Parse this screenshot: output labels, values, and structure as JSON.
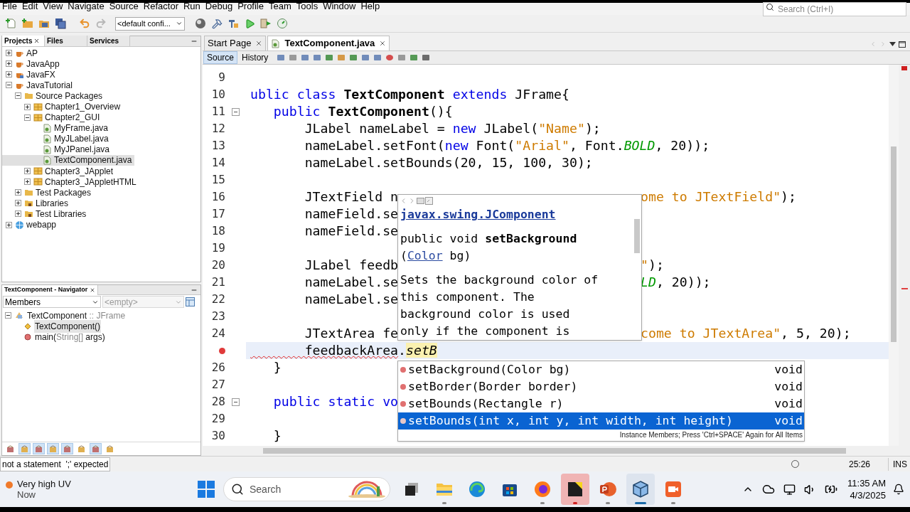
{
  "menu": [
    "File",
    "Edit",
    "View",
    "Navigate",
    "Source",
    "Refactor",
    "Run",
    "Debug",
    "Profile",
    "Team",
    "Tools",
    "Window",
    "Help"
  ],
  "search": {
    "placeholder": "Search (Ctrl+I)"
  },
  "toolbar": {
    "config": "<default confi..."
  },
  "projects_panel": {
    "tabs": [
      {
        "label": "Projects",
        "selected": true
      },
      {
        "label": "Files",
        "selected": false
      },
      {
        "label": "Services",
        "selected": false
      }
    ],
    "tree": [
      {
        "label": "AP",
        "kind": "project",
        "expanded": false,
        "selected": false
      },
      {
        "label": "JavaApp",
        "kind": "project",
        "expanded": false,
        "selected": false
      },
      {
        "label": "JavaFX",
        "kind": "fx-project",
        "expanded": false,
        "selected": false
      },
      {
        "label": "JavaTutorial",
        "kind": "project",
        "expanded": true,
        "selected": false,
        "children": [
          {
            "label": "Source Packages",
            "kind": "folder",
            "expanded": true,
            "selected": false,
            "children": [
              {
                "label": "Chapter1_Overview",
                "kind": "package",
                "expanded": false,
                "selected": false
              },
              {
                "label": "Chapter2_GUI",
                "kind": "package",
                "expanded": true,
                "selected": false,
                "children": [
                  {
                    "label": "MyFrame.java",
                    "kind": "java",
                    "selected": false
                  },
                  {
                    "label": "MyJLabel.java",
                    "kind": "java",
                    "selected": false
                  },
                  {
                    "label": "MyJPanel.java",
                    "kind": "java",
                    "selected": false
                  },
                  {
                    "label": "TextComponent.java",
                    "kind": "java",
                    "selected": true
                  }
                ]
              },
              {
                "label": "Chapter3_JApplet",
                "kind": "package",
                "expanded": false,
                "selected": false
              },
              {
                "label": "Chapter3_JAppletHTML",
                "kind": "package",
                "expanded": false,
                "selected": false
              }
            ]
          },
          {
            "label": "Test Packages",
            "kind": "folder",
            "expanded": false,
            "selected": false
          },
          {
            "label": "Libraries",
            "kind": "library",
            "expanded": false,
            "selected": false
          },
          {
            "label": "Test Libraries",
            "kind": "library",
            "expanded": false,
            "selected": false
          }
        ]
      },
      {
        "label": "webapp",
        "kind": "web",
        "expanded": false,
        "selected": false
      }
    ]
  },
  "navigator": {
    "title": "TextComponent - Navigator",
    "filter": "Members",
    "scope": "<empty>",
    "tree": [
      {
        "kind": "class",
        "expanded": true,
        "selected": false,
        "parts": [
          {
            "text": "TextComponent",
            "muted": false
          },
          {
            "text": " :: JFrame",
            "muted": true
          }
        ],
        "children": [
          {
            "kind": "constructor",
            "selected": true,
            "parts": [
              {
                "text": "TextComponent()",
                "muted": false
              }
            ]
          },
          {
            "kind": "method",
            "selected": false,
            "parts": [
              {
                "text": "main(",
                "muted": false
              },
              {
                "text": "String[]",
                "muted": true
              },
              {
                "text": " args)",
                "muted": false
              }
            ]
          }
        ]
      }
    ],
    "tools": [
      {
        "on": false
      },
      {
        "on": true
      },
      {
        "on": true
      },
      {
        "on": true
      },
      {
        "on": true
      },
      {
        "on": false
      },
      {
        "on": true
      },
      {
        "on": false
      }
    ]
  },
  "editor": {
    "tabs": [
      {
        "label": "Start Page",
        "selected": false
      },
      {
        "label": "TextComponent.java",
        "selected": true
      }
    ],
    "views": [
      {
        "label": "Source",
        "selected": true
      },
      {
        "label": "History",
        "selected": false
      }
    ],
    "lines": [
      {
        "number": "9",
        "error": false,
        "fold": false,
        "current": false
      },
      {
        "number": "10",
        "error": false,
        "fold": false,
        "current": false,
        "segments": [
          {
            "kind": "keyword",
            "text": "ublic"
          },
          {
            "kind": "keyword",
            "text": " class"
          },
          {
            "kind": "bold",
            "text": " TextComponent"
          },
          {
            "kind": "keyword",
            "text": " extends"
          },
          {
            "kind": "plain",
            "text": " JFrame{"
          }
        ]
      },
      {
        "number": "11",
        "error": false,
        "fold": true,
        "current": false,
        "segments": [
          {
            "kind": "keyword",
            "text": "   public"
          },
          {
            "kind": "bold",
            "text": " TextComponent"
          },
          {
            "kind": "plain",
            "text": "(){"
          }
        ]
      },
      {
        "number": "12",
        "error": false,
        "fold": false,
        "current": false,
        "segments": [
          {
            "kind": "plain",
            "text": "       JLabel nameLabel = "
          },
          {
            "kind": "keyword",
            "text": "new"
          },
          {
            "kind": "plain",
            "text": " JLabel("
          },
          {
            "kind": "string",
            "text": "\"Name\""
          },
          {
            "kind": "plain",
            "text": ");"
          }
        ]
      },
      {
        "number": "13",
        "error": false,
        "fold": false,
        "current": false,
        "segments": [
          {
            "kind": "plain",
            "text": "       nameLabel.setFont("
          },
          {
            "kind": "keyword",
            "text": "new"
          },
          {
            "kind": "plain",
            "text": " Font("
          },
          {
            "kind": "string",
            "text": "\"Arial\""
          },
          {
            "kind": "plain",
            "text": ", Font."
          },
          {
            "kind": "constant",
            "text": "BOLD"
          },
          {
            "kind": "plain",
            "text": ", 20));"
          }
        ]
      },
      {
        "number": "14",
        "error": false,
        "fold": false,
        "current": false,
        "segments": [
          {
            "kind": "plain",
            "text": "       nameLabel.setBounds(20, 15, 100, 30);"
          }
        ]
      },
      {
        "number": "15",
        "error": false,
        "fold": false,
        "current": false
      },
      {
        "number": "16",
        "error": false,
        "fold": false,
        "current": false,
        "segments": [
          {
            "kind": "plain",
            "text": "       JTextField n"
          }
        ],
        "tail": [
          {
            "kind": "string",
            "text": "ome to JTextField\""
          },
          {
            "kind": "plain",
            "text": ");"
          }
        ]
      },
      {
        "number": "17",
        "error": false,
        "fold": false,
        "current": false,
        "segments": [
          {
            "kind": "plain",
            "text": "       nameField.se"
          }
        ]
      },
      {
        "number": "18",
        "error": false,
        "fold": false,
        "current": false,
        "segments": [
          {
            "kind": "plain",
            "text": "       nameField.se"
          }
        ]
      },
      {
        "number": "19",
        "error": false,
        "fold": false,
        "current": false
      },
      {
        "number": "20",
        "error": false,
        "fold": false,
        "current": false,
        "segments": [
          {
            "kind": "plain",
            "text": "       JLabel feedb"
          }
        ],
        "tail": [
          {
            "kind": "string",
            "text": "\""
          },
          {
            "kind": "plain",
            "text": ");"
          }
        ]
      },
      {
        "number": "21",
        "error": false,
        "fold": false,
        "current": false,
        "segments": [
          {
            "kind": "plain",
            "text": "       nameLabel.se"
          }
        ],
        "tail": [
          {
            "kind": "constant",
            "text": "LD"
          },
          {
            "kind": "plain",
            "text": ", 20));"
          }
        ]
      },
      {
        "number": "22",
        "error": false,
        "fold": false,
        "current": false,
        "segments": [
          {
            "kind": "plain",
            "text": "       nameLabel.se"
          }
        ]
      },
      {
        "number": "23",
        "error": false,
        "fold": false,
        "current": false
      },
      {
        "number": "24",
        "error": false,
        "fold": false,
        "current": false,
        "segments": [
          {
            "kind": "plain",
            "text": "       JTextArea fe"
          }
        ],
        "tail": [
          {
            "kind": "string",
            "text": "come to JTextArea\""
          },
          {
            "kind": "plain",
            "text": ", 5, 20);"
          }
        ]
      },
      {
        "error": true,
        "fold": false,
        "current": true,
        "segments": [
          {
            "kind": "error",
            "text": "       feedbackArea"
          },
          {
            "kind": "plain",
            "text": "."
          },
          {
            "kind": "typed",
            "text": "setB"
          }
        ]
      },
      {
        "number": "26",
        "error": false,
        "fold": false,
        "current": false,
        "segments": [
          {
            "kind": "plain",
            "text": "   }"
          }
        ]
      },
      {
        "number": "27",
        "error": false,
        "fold": false,
        "current": false
      },
      {
        "number": "28",
        "error": false,
        "fold": true,
        "current": false,
        "segments": [
          {
            "kind": "keyword",
            "text": "   public static vo"
          }
        ]
      },
      {
        "number": "29",
        "error": false,
        "fold": false,
        "current": false
      },
      {
        "number": "30",
        "error": false,
        "fold": false,
        "current": false,
        "segments": [
          {
            "kind": "plain",
            "text": "   }"
          }
        ]
      }
    ],
    "doc_popup": {
      "link": "javax.swing.JComponent",
      "signature": "public void **setBackground**",
      "params": {
        "open": "(",
        "link": "Color",
        "rest": " bg)"
      },
      "description": "Sets the background color of this component. The background color is used only if the component is"
    },
    "completion": {
      "items": [
        {
          "label": "setBackground(Color bg)",
          "type": "void",
          "selected": false
        },
        {
          "label": "setBorder(Border border)",
          "type": "void",
          "selected": false
        },
        {
          "label": "setBounds(Rectangle r)",
          "type": "void",
          "selected": false
        },
        {
          "label": "setBounds(int x, int y, int width, int height)",
          "type": "void",
          "selected": true
        }
      ],
      "footer": "Instance Members; Press 'Ctrl+SPACE' Again for All Items"
    }
  },
  "status_bar": {
    "message": "not a statement  ';' expected",
    "position": "25:26",
    "mode": "INS"
  },
  "taskbar": {
    "weather": {
      "title": "Very high UV",
      "subtitle": "Now"
    },
    "search": {
      "placeholder": "Search"
    },
    "apps": [
      {
        "kind": "task-view",
        "active": false,
        "running": false
      },
      {
        "kind": "explorer",
        "active": false,
        "running": true
      },
      {
        "kind": "edge",
        "active": false,
        "running": false
      },
      {
        "kind": "store",
        "active": false,
        "running": false
      },
      {
        "kind": "firefox",
        "active": false,
        "running": true
      },
      {
        "kind": "notes",
        "active": true,
        "running": true
      },
      {
        "kind": "powerpoint",
        "active": false,
        "running": true
      },
      {
        "kind": "netbeans",
        "active": true,
        "running": true
      },
      {
        "kind": "camera",
        "active": false,
        "running": true
      }
    ],
    "time": "11:35 AM",
    "date": "4/3/2025"
  }
}
